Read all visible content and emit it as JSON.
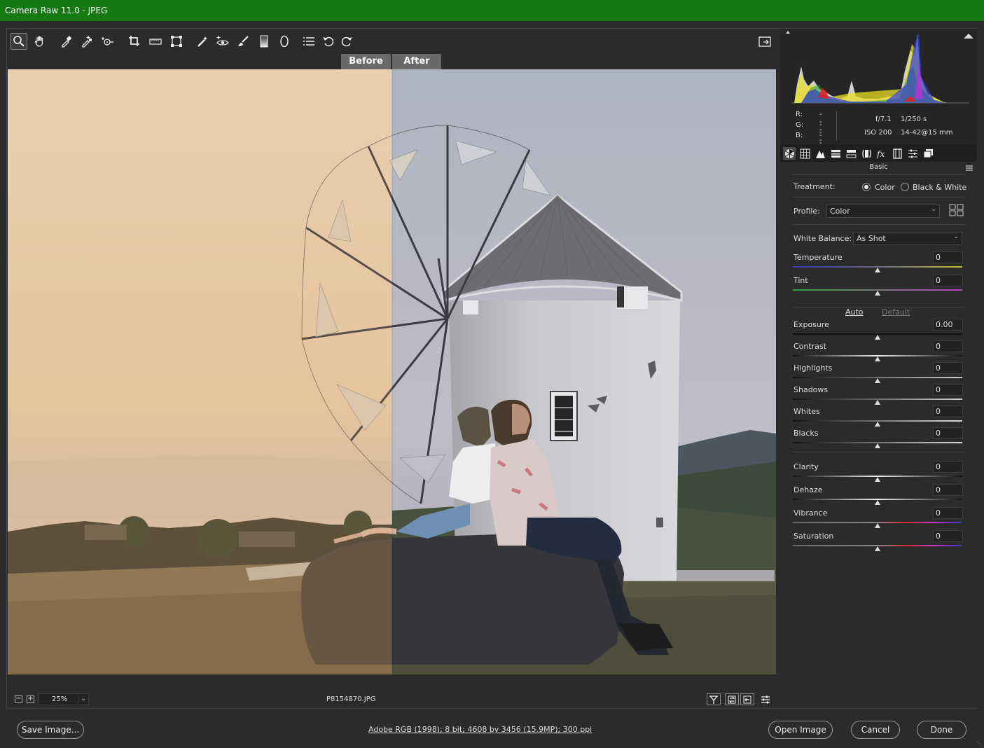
{
  "window": {
    "title": "Camera Raw 11.0  -  JPEG"
  },
  "toolbar": {
    "tools": [
      {
        "name": "zoom-tool-icon",
        "active": true
      },
      {
        "name": "hand-tool-icon"
      },
      {
        "name": "white-balance-tool-icon"
      },
      {
        "name": "color-sampler-tool-icon"
      },
      {
        "name": "targeted-adjustment-tool-icon"
      },
      {
        "name": "crop-tool-icon"
      },
      {
        "name": "straighten-tool-icon"
      },
      {
        "name": "transform-tool-icon"
      },
      {
        "name": "spot-removal-tool-icon"
      },
      {
        "name": "red-eye-removal-icon"
      },
      {
        "name": "adjustment-brush-icon"
      },
      {
        "name": "graduated-filter-icon"
      },
      {
        "name": "radial-filter-icon"
      },
      {
        "name": "preferences-icon"
      },
      {
        "name": "rotate-ccw-icon"
      },
      {
        "name": "rotate-cw-icon"
      }
    ],
    "fullscreen_icon": "toggle-fullscreen-icon"
  },
  "compare": {
    "before_label": "Before",
    "after_label": "After"
  },
  "statusbar": {
    "zoom_out": "−",
    "zoom_in": "+",
    "zoom_value": "25%",
    "filename": "P8154870.JPG",
    "view_icons": [
      "before-after-view-icon",
      "swap-settings-icon",
      "copy-settings-icon",
      "toggle-settings-icon"
    ]
  },
  "histogram": {
    "r_label": "R:",
    "r_value": "---",
    "g_label": "G:",
    "g_value": "---",
    "b_label": "B:",
    "b_value": "---",
    "aperture": "f/7.1",
    "shutter": "1/250 s",
    "iso": "ISO 200",
    "lens": "14-42@15 mm"
  },
  "panel_tabs": [
    "basic-icon",
    "tone-curve-icon",
    "detail-icon",
    "hsl-icon",
    "split-toning-icon",
    "lens-corrections-icon",
    "effects-icon",
    "camera-calibration-icon",
    "presets-icon",
    "snapshots-icon"
  ],
  "basic": {
    "title": "Basic",
    "treatment_label": "Treatment:",
    "color_option": "Color",
    "bw_option": "Black & White",
    "profile_label": "Profile:",
    "profile_value": "Color",
    "wb_label": "White Balance:",
    "wb_value": "As Shot",
    "auto_label": "Auto",
    "default_label": "Default",
    "sliders": [
      {
        "label": "Temperature",
        "value": "0",
        "level": 0.5
      },
      {
        "label": "Tint",
        "value": "0",
        "level": 0.5
      },
      {
        "label": "Exposure",
        "value": "0.00",
        "level": 0.5
      },
      {
        "label": "Contrast",
        "value": "0",
        "level": 0.5
      },
      {
        "label": "Highlights",
        "value": "0",
        "level": 0.5
      },
      {
        "label": "Shadows",
        "value": "0",
        "level": 0.5
      },
      {
        "label": "Whites",
        "value": "0",
        "level": 0.5
      },
      {
        "label": "Blacks",
        "value": "0",
        "level": 0.5
      },
      {
        "label": "Clarity",
        "value": "0",
        "level": 0.5
      },
      {
        "label": "Dehaze",
        "value": "0",
        "level": 0.5
      },
      {
        "label": "Vibrance",
        "value": "0",
        "level": 0.5
      },
      {
        "label": "Saturation",
        "value": "0",
        "level": 0.5
      }
    ]
  },
  "footer": {
    "save_label": "Save Image...",
    "info_link": "Adobe RGB (1998); 8 bit; 4608 by 3456 (15.9MP); 300 ppi",
    "open_label": "Open Image",
    "cancel_label": "Cancel",
    "done_label": "Done"
  },
  "colors": {
    "titlebar": "#137a12",
    "panel_bg": "#2b2b2b",
    "before_tint": "#e8d2b3",
    "after_sky": "#b4b9c7"
  }
}
